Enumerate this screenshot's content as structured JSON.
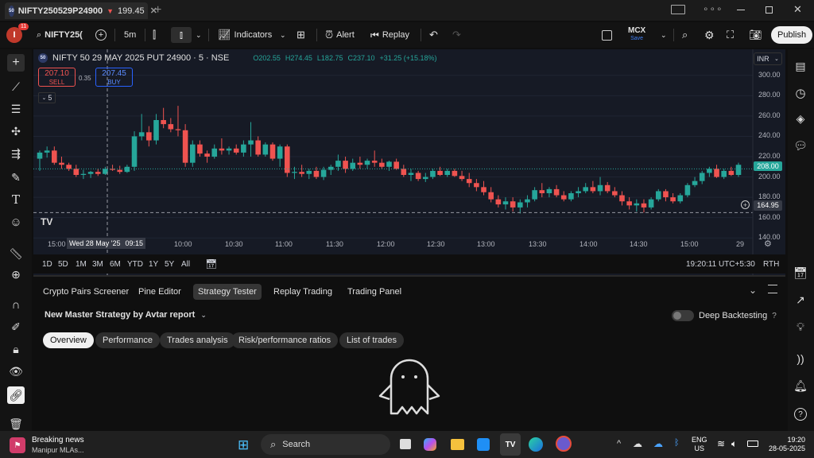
{
  "tab": {
    "title": "NIFTY250529P24900",
    "arrow": "▼",
    "price": "199.45"
  },
  "toolbar": {
    "symbol": "NIFTY25(",
    "timeframe": "5m",
    "indicators": "Indicators",
    "alert": "Alert",
    "replay": "Replay",
    "mcx": "MCX",
    "save": "Save",
    "publish": "Publish",
    "notif_count": "11"
  },
  "chart": {
    "title": "NIFTY 50 29 MAY 2025 PUT 24900 · 5 · NSE",
    "ohlc": {
      "o": "O202.55",
      "h": "H274.45",
      "l": "L182.75",
      "c": "C237.10",
      "chg": "+31.25 (+15.18%)"
    },
    "sell": {
      "price": "207.10",
      "label": "SELL"
    },
    "spread": "0.35",
    "buy": {
      "price": "207.45",
      "label": "BUY"
    },
    "indicator_count": "5",
    "currency": "INR",
    "last_price": "208.00",
    "cursor_price": "164.95",
    "cursor_date": "Wed 28 May '25",
    "cursor_time": "09:15",
    "yaxis": [
      "300.00",
      "280.00",
      "260.00",
      "240.00",
      "220.00",
      "200.00",
      "180.00",
      "160.00",
      "140.00"
    ],
    "xaxis": [
      "15:00",
      "10:00",
      "10:30",
      "11:00",
      "11:30",
      "12:00",
      "12:30",
      "13:00",
      "13:30",
      "14:00",
      "14:30",
      "15:00",
      "29"
    ],
    "ranges": [
      "1D",
      "5D",
      "1M",
      "3M",
      "6M",
      "YTD",
      "1Y",
      "5Y",
      "All"
    ],
    "clock": "19:20:11 UTC+5:30",
    "rth": "RTH",
    "colors": {
      "up": "#26a69a",
      "down": "#ef5350",
      "bg": "#161a25"
    }
  },
  "chart_data": {
    "type": "candlestick",
    "ylim": [
      130,
      310
    ],
    "candles": [
      [
        218,
        226,
        206,
        224
      ],
      [
        224,
        230,
        219,
        226
      ],
      [
        226,
        230,
        212,
        214
      ],
      [
        214,
        220,
        208,
        212
      ],
      [
        212,
        214,
        206,
        208
      ],
      [
        208,
        212,
        200,
        202
      ],
      [
        202,
        207,
        198,
        203
      ],
      [
        203,
        206,
        199,
        205
      ],
      [
        205,
        208,
        201,
        203
      ],
      [
        203,
        210,
        202,
        208
      ],
      [
        208,
        212,
        206,
        207
      ],
      [
        207,
        211,
        203,
        205
      ],
      [
        205,
        212,
        204,
        210
      ],
      [
        210,
        245,
        206,
        240
      ],
      [
        240,
        262,
        236,
        244
      ],
      [
        244,
        250,
        230,
        236
      ],
      [
        236,
        262,
        232,
        256
      ],
      [
        256,
        268,
        248,
        252
      ],
      [
        252,
        258,
        244,
        247
      ],
      [
        247,
        270,
        240,
        246
      ],
      [
        246,
        252,
        210,
        214
      ],
      [
        214,
        236,
        210,
        232
      ],
      [
        232,
        236,
        220,
        223
      ],
      [
        223,
        226,
        214,
        220
      ],
      [
        220,
        232,
        218,
        228
      ],
      [
        228,
        238,
        222,
        226
      ],
      [
        226,
        230,
        222,
        228
      ],
      [
        228,
        232,
        222,
        224
      ],
      [
        224,
        236,
        220,
        232
      ],
      [
        232,
        254,
        220,
        236
      ],
      [
        236,
        240,
        220,
        222
      ],
      [
        222,
        234,
        220,
        232
      ],
      [
        232,
        234,
        216,
        218
      ],
      [
        218,
        232,
        210,
        230
      ],
      [
        230,
        232,
        200,
        204
      ],
      [
        204,
        210,
        198,
        205
      ],
      [
        205,
        212,
        200,
        203
      ],
      [
        203,
        208,
        198,
        206
      ],
      [
        206,
        210,
        198,
        200
      ],
      [
        200,
        210,
        197,
        207
      ],
      [
        207,
        212,
        202,
        210
      ],
      [
        210,
        222,
        206,
        216
      ],
      [
        216,
        220,
        204,
        208
      ],
      [
        208,
        218,
        206,
        214
      ],
      [
        214,
        220,
        208,
        212
      ],
      [
        212,
        218,
        208,
        216
      ],
      [
        216,
        226,
        210,
        214
      ],
      [
        214,
        218,
        208,
        210
      ],
      [
        210,
        216,
        206,
        215
      ],
      [
        215,
        218,
        207,
        208
      ],
      [
        208,
        212,
        200,
        202
      ],
      [
        202,
        208,
        196,
        204
      ],
      [
        204,
        206,
        196,
        198
      ],
      [
        198,
        204,
        195,
        200
      ],
      [
        200,
        208,
        198,
        206
      ],
      [
        206,
        210,
        201,
        202
      ],
      [
        202,
        208,
        200,
        206
      ],
      [
        206,
        208,
        200,
        201
      ],
      [
        201,
        206,
        196,
        198
      ],
      [
        198,
        204,
        190,
        194
      ],
      [
        194,
        198,
        186,
        190
      ],
      [
        190,
        196,
        182,
        185
      ],
      [
        185,
        190,
        175,
        178
      ],
      [
        178,
        182,
        170,
        173
      ],
      [
        173,
        180,
        168,
        176
      ],
      [
        176,
        180,
        166,
        170
      ],
      [
        170,
        178,
        164,
        175
      ],
      [
        175,
        182,
        170,
        178
      ],
      [
        178,
        190,
        176,
        187
      ],
      [
        187,
        194,
        180,
        184
      ],
      [
        184,
        190,
        180,
        188
      ],
      [
        188,
        192,
        180,
        182
      ],
      [
        182,
        186,
        176,
        178
      ],
      [
        178,
        186,
        176,
        184
      ],
      [
        184,
        190,
        180,
        186
      ],
      [
        186,
        194,
        184,
        190
      ],
      [
        190,
        196,
        184,
        186
      ],
      [
        186,
        200,
        182,
        192
      ],
      [
        192,
        195,
        184,
        186
      ],
      [
        186,
        190,
        180,
        182
      ],
      [
        182,
        186,
        172,
        176
      ],
      [
        176,
        180,
        168,
        172
      ],
      [
        172,
        178,
        166,
        174
      ],
      [
        174,
        178,
        165,
        170
      ],
      [
        170,
        180,
        168,
        178
      ],
      [
        178,
        188,
        176,
        186
      ],
      [
        186,
        188,
        176,
        180
      ],
      [
        180,
        184,
        174,
        176
      ],
      [
        176,
        184,
        174,
        182
      ],
      [
        182,
        194,
        180,
        192
      ],
      [
        192,
        200,
        190,
        196
      ],
      [
        196,
        206,
        193,
        204
      ],
      [
        204,
        210,
        200,
        208
      ],
      [
        208,
        212,
        199,
        200
      ],
      [
        200,
        208,
        198,
        206
      ],
      [
        206,
        210,
        201,
        202
      ],
      [
        202,
        214,
        200,
        212
      ]
    ]
  },
  "panel": {
    "tabs": [
      "Crypto Pairs Screener",
      "Pine Editor",
      "Strategy Tester",
      "Replay Trading",
      "Trading Panel"
    ],
    "strategy": "New Master Strategy by Avtar report",
    "deep": "Deep Backtesting",
    "pills": [
      "Overview",
      "Performance",
      "Trades analysis",
      "Risk/performance ratios",
      "List of trades"
    ]
  },
  "taskbar": {
    "news_title": "Breaking news",
    "news_sub": "Manipur MLAs...",
    "search": "Search",
    "lang1": "ENG",
    "lang2": "US",
    "time": "19:20",
    "date": "28-05-2025"
  }
}
